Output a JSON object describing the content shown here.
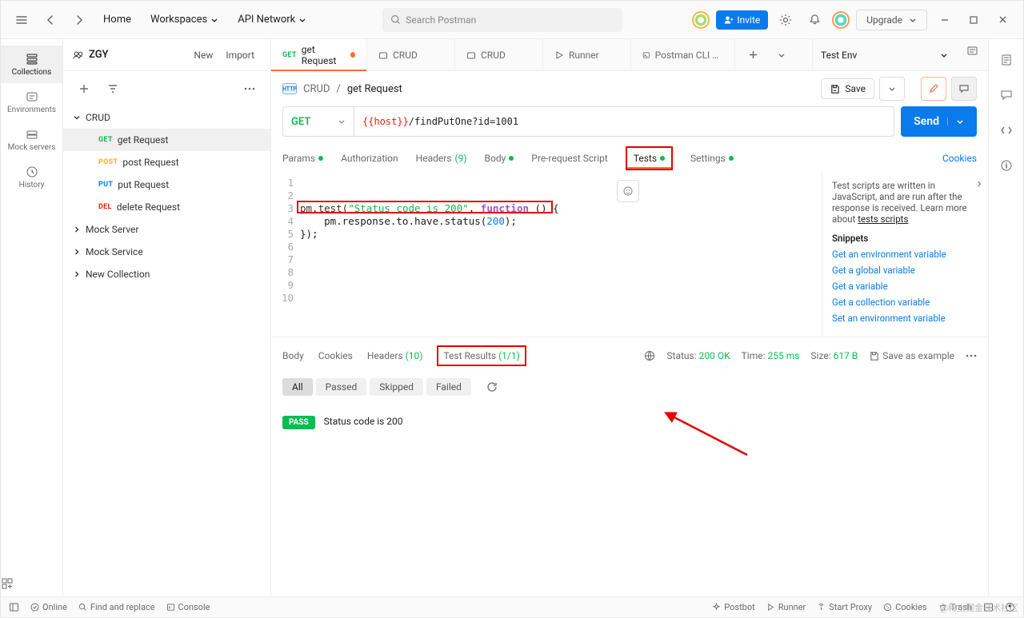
{
  "topbar": {
    "home": "Home",
    "workspaces": "Workspaces",
    "api_network": "API Network",
    "search_placeholder": "Search Postman",
    "invite": "Invite",
    "upgrade": "Upgrade"
  },
  "rail": {
    "collections": "Collections",
    "environments": "Environments",
    "mock": "Mock servers",
    "history": "History"
  },
  "workspace": {
    "name": "ZGY",
    "new_btn": "New",
    "import_btn": "Import"
  },
  "tree": {
    "root": "CRUD",
    "items": [
      {
        "method": "GET",
        "label": "get Request"
      },
      {
        "method": "POST",
        "label": "post Request"
      },
      {
        "method": "PUT",
        "label": "put Request"
      },
      {
        "method": "DEL",
        "label": "delete Request"
      }
    ],
    "folders": [
      "Mock Server",
      "Mock Service",
      "New Collection"
    ]
  },
  "tabs": {
    "items": [
      {
        "kind": "GET",
        "label": "get Request",
        "dirty": true
      },
      {
        "kind": "COL",
        "label": "CRUD",
        "dirty": false
      },
      {
        "kind": "COL",
        "label": "CRUD",
        "dirty": false
      },
      {
        "kind": "RUN",
        "label": "Runner",
        "dirty": false
      },
      {
        "kind": "CFG",
        "label": "Postman CLI Config",
        "dirty": false
      }
    ],
    "env": "Test Env"
  },
  "crumb": {
    "col": "CRUD",
    "req": "get Request",
    "save": "Save"
  },
  "request": {
    "method": "GET",
    "url_var": "{{host}}",
    "url_rest": "/findPutOne?id=1001",
    "send": "Send"
  },
  "req_tabs": {
    "params": "Params",
    "auth": "Authorization",
    "headers": "Headers",
    "headers_count": "(9)",
    "body": "Body",
    "prereq": "Pre-request Script",
    "tests": "Tests",
    "settings": "Settings",
    "cookies": "Cookies"
  },
  "code": {
    "l3a": "pm.test(",
    "l3b": "\"Status code is 200\"",
    "l3c": ", ",
    "l3d": "function",
    "l3e": " () {",
    "l4a": "    pm.response.to.have.status(",
    "l4b": "200",
    "l4c": ");",
    "l5": "});"
  },
  "hint": {
    "text1": "Test scripts are written in JavaScript, and are run after the response is received. Learn more about ",
    "link": "tests scripts",
    "snippets_hdr": "Snippets",
    "s1": "Get an environment variable",
    "s2": "Get a global variable",
    "s3": "Get a variable",
    "s4": "Get a collection variable",
    "s5": "Set an environment variable"
  },
  "resp": {
    "body": "Body",
    "cookies": "Cookies",
    "headers": "Headers",
    "headers_count": "(10)",
    "test_results": "Test Results",
    "tr_count": "(1/1)",
    "status_lbl": "Status:",
    "status_val": "200 OK",
    "time_lbl": "Time:",
    "time_val": "255 ms",
    "size_lbl": "Size:",
    "size_val": "617 B",
    "save_as": "Save as example"
  },
  "filters": {
    "all": "All",
    "passed": "Passed",
    "skipped": "Skipped",
    "failed": "Failed"
  },
  "result": {
    "badge": "PASS",
    "text": "Status code is 200"
  },
  "footer": {
    "online": "Online",
    "find": "Find and replace",
    "console": "Console",
    "postbot": "Postbot",
    "runner": "Runner",
    "proxy": "Start Proxy",
    "cookies": "Cookies",
    "trash": "Trash"
  },
  "watermark": "@稀土掘金技术社区"
}
